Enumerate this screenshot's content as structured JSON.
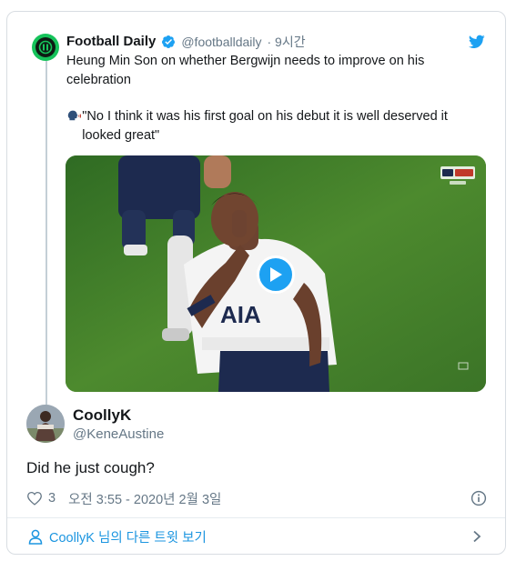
{
  "quoted_tweet": {
    "author_name": "Football Daily",
    "author_handle": "@footballdaily",
    "time_ago": "· 9시간",
    "text_line1": "Heung Min Son on whether Bergwijn needs to improve on his celebration",
    "text_quote": "\"No I think it was his first goal on his debut it is well deserved it looked great\"",
    "media": {
      "type": "video",
      "overlay_icon": "play-icon"
    },
    "icons": [
      "verified-icon",
      "twitter-bird-icon",
      "speaking-head-icon"
    ]
  },
  "main_tweet": {
    "author_name": "CoollyK",
    "author_handle": "@KeneAustine",
    "text": "Did he just cough?",
    "like_count": "3",
    "timestamp": "오전 3:55 - 2020년 2월 3일"
  },
  "footer": {
    "more_tweets_label": "CoollyK 님의 다른 트윗 보기"
  },
  "colors": {
    "accent": "#1da1f2",
    "link": "#1b95e0",
    "secondary_text": "#657786",
    "border": "#d8dde2",
    "football_daily_green": "#16c35b"
  }
}
